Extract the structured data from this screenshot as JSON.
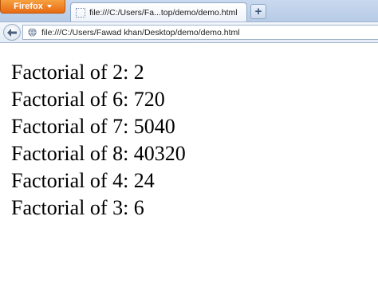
{
  "browser": {
    "menu_button_label": "Firefox",
    "tab_title": "file:///C:/Users/Fa...top/demo/demo.html",
    "new_tab_label": "+",
    "url": "file:///C:/Users/Fawad khan/Desktop/demo/demo.html"
  },
  "page": {
    "lines": [
      "Factorial of 2: 2",
      "Factorial of 6: 720",
      "Factorial of 7: 5040",
      "Factorial of 8: 40320",
      "Factorial of 4: 24",
      "Factorial of 3: 6"
    ]
  },
  "icons": {
    "back": "arrow-left-icon",
    "site": "globe-icon",
    "favicon": "blank-page-icon",
    "menu_caret": "caret-down-icon"
  },
  "colors": {
    "firefox_button": "#e66a12",
    "tabstrip": "#c9d9ee",
    "page_text": "#000000"
  }
}
